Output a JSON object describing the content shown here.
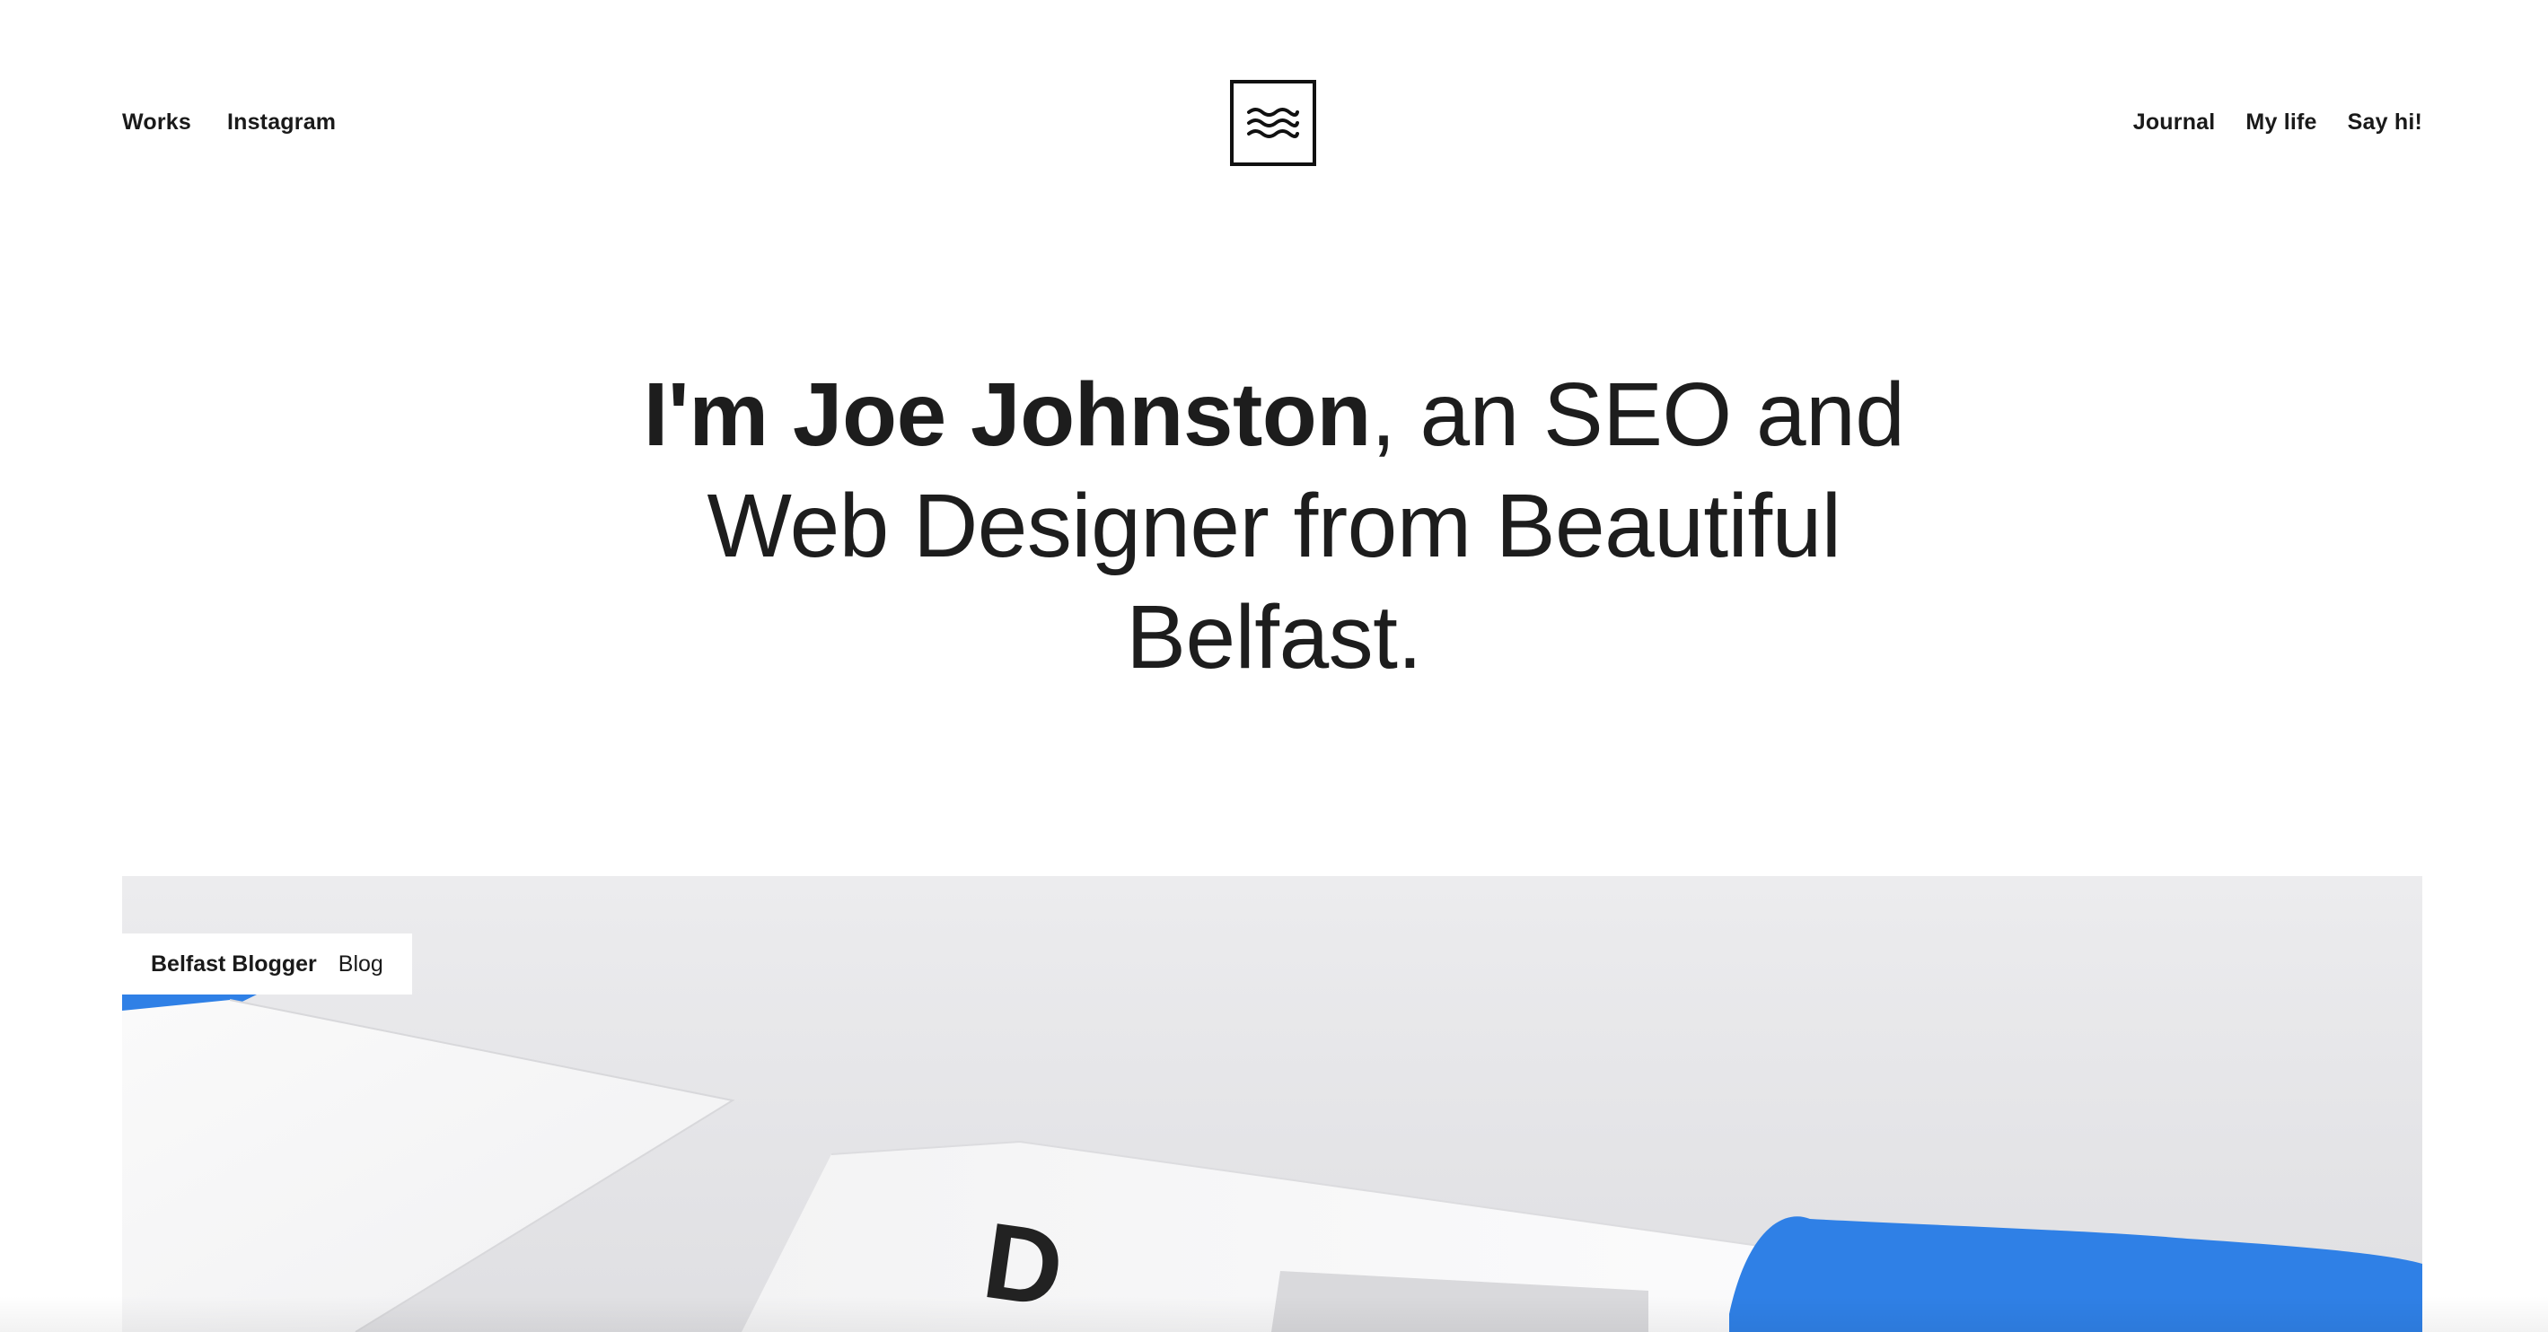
{
  "nav": {
    "left": [
      {
        "label": "Works"
      },
      {
        "label": "Instagram"
      }
    ],
    "right": [
      {
        "label": "Journal"
      },
      {
        "label": "My life"
      },
      {
        "label": "Say hi!"
      }
    ]
  },
  "logo": {
    "icon": "waves-icon"
  },
  "hero": {
    "name": "I'm Joe Johnston",
    "line1_rest": ", an SEO and",
    "line2": "Web Designer from Beautiful",
    "line3": "Belfast."
  },
  "featured": {
    "title": "Belfast Blogger",
    "category": "Blog",
    "image_letter": "D"
  },
  "colors": {
    "accent_blue": "#2f80e6",
    "text": "#1a1a1a",
    "background": "#ffffff"
  }
}
